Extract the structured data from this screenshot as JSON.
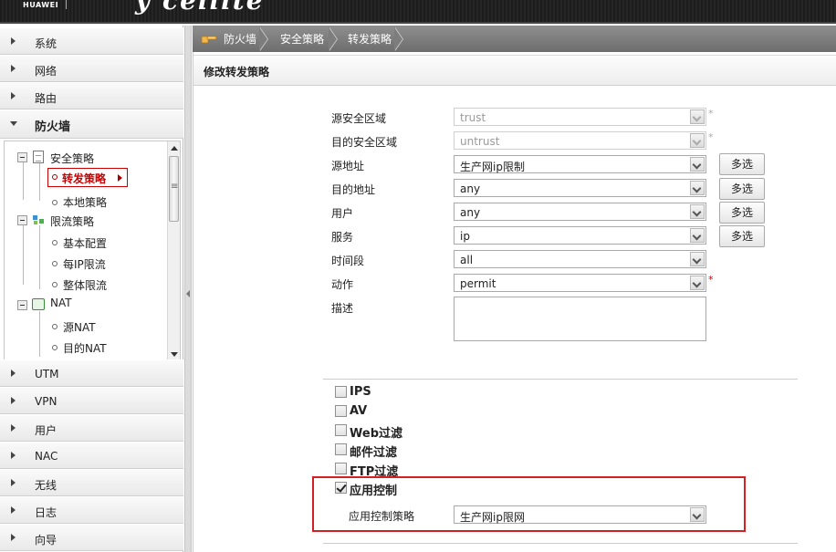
{
  "banner": {
    "brand": "HUAWEI",
    "product": "y cellite"
  },
  "sidebar": {
    "sections_top": [
      {
        "label": "系统",
        "expanded": false
      },
      {
        "label": "网络",
        "expanded": false
      },
      {
        "label": "路由",
        "expanded": false
      },
      {
        "label": "防火墙",
        "expanded": true
      }
    ],
    "tree": {
      "security_policy": "安全策略",
      "forward_policy": "转发策略",
      "local_policy": "本地策略",
      "rate_limit": "限流策略",
      "basic_config": "基本配置",
      "per_ip_limit": "每IP限流",
      "overall_limit": "整体限流",
      "nat": "NAT",
      "source_nat": "源NAT",
      "dest_nat": "目的NAT"
    },
    "sections_bottom": [
      {
        "label": "UTM"
      },
      {
        "label": "VPN"
      },
      {
        "label": "用户"
      },
      {
        "label": "NAC"
      },
      {
        "label": "无线"
      },
      {
        "label": "日志"
      },
      {
        "label": "向导"
      }
    ]
  },
  "breadcrumb": [
    "防火墙",
    "安全策略",
    "转发策略"
  ],
  "panel": {
    "title": "修改转发策略",
    "fields": {
      "src_zone": {
        "label": "源安全区域",
        "value": "trust"
      },
      "dst_zone": {
        "label": "目的安全区域",
        "value": "untrust"
      },
      "src_addr": {
        "label": "源地址",
        "value": "生产网ip限制"
      },
      "dst_addr": {
        "label": "目的地址",
        "value": "any"
      },
      "user": {
        "label": "用户",
        "value": "any"
      },
      "service": {
        "label": "服务",
        "value": "ip"
      },
      "schedule": {
        "label": "时间段",
        "value": "all"
      },
      "action": {
        "label": "动作",
        "value": "permit"
      },
      "description": {
        "label": "描述",
        "value": ""
      }
    },
    "multi_select_label": "多选",
    "required_mark": "*",
    "options": [
      {
        "label": "IPS",
        "checked": false
      },
      {
        "label": "AV",
        "checked": false
      },
      {
        "label": "Web过滤",
        "checked": false
      },
      {
        "label": "邮件过滤",
        "checked": false
      },
      {
        "label": "FTP过滤",
        "checked": false
      },
      {
        "label": "应用控制",
        "checked": true
      }
    ],
    "app_control_policy": {
      "label": "应用控制策略",
      "value": "生产网ip限网"
    }
  },
  "colors": {
    "highlight": "#d42020",
    "selected_text": "#cc0000"
  }
}
